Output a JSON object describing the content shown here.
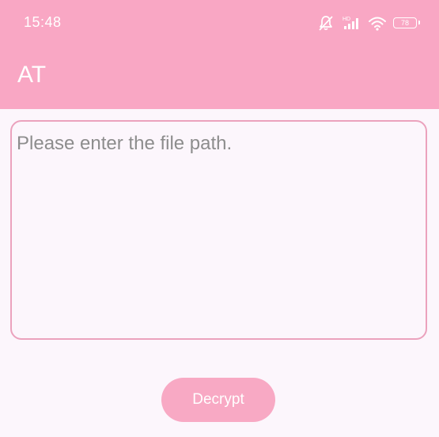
{
  "status_bar": {
    "time": "15:48",
    "signal_label": "HD",
    "battery_level": "78",
    "icons": [
      "mute-bell-icon",
      "signal-icon",
      "wifi-icon",
      "battery-icon"
    ]
  },
  "app_bar": {
    "title": "AT"
  },
  "main": {
    "path_input": {
      "value": "",
      "placeholder": "Please enter the file path."
    },
    "decrypt_label": "Decrypt"
  },
  "colors": {
    "primary": "#f9a7c4",
    "background": "#fcf6fc",
    "input_border": "#eba2bd",
    "placeholder": "#8d8d8d"
  }
}
